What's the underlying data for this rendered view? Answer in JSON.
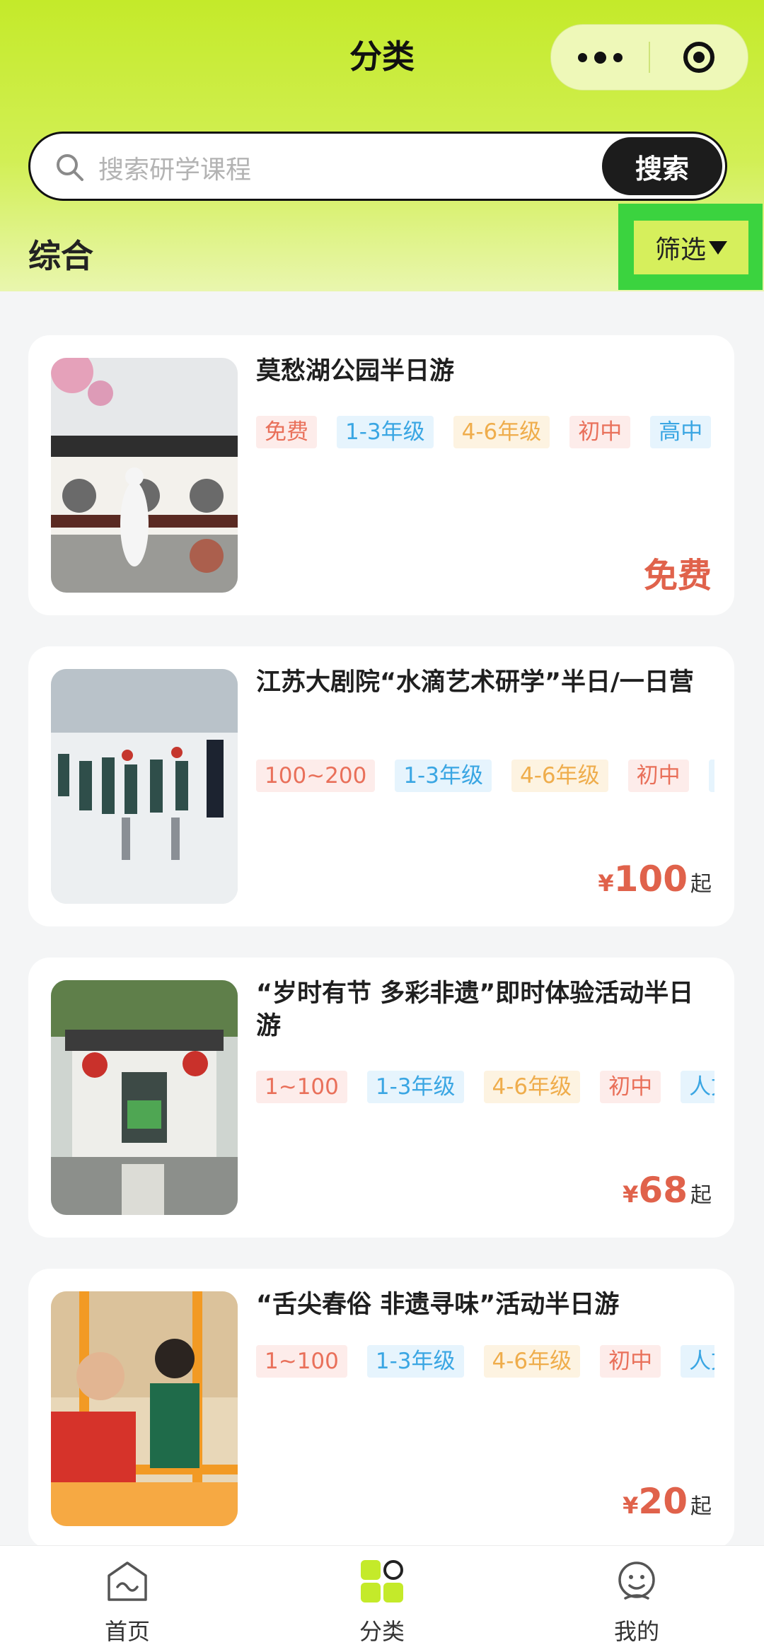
{
  "nav": {
    "title": "分类"
  },
  "search": {
    "placeholder": "搜索研学课程",
    "button": "搜索"
  },
  "sort": {
    "label": "综合"
  },
  "filter": {
    "label": "筛选"
  },
  "courses": [
    {
      "title": "莫愁湖公园半日游",
      "tags": [
        "免费",
        "1-3年级",
        "4-6年级",
        "初中",
        "高中"
      ],
      "price": {
        "text": "免费"
      }
    },
    {
      "title": "江苏大剧院“水滴艺术研学”半日/一日营",
      "tags": [
        "100~200",
        "1-3年级",
        "4-6年级",
        "初中",
        "人"
      ],
      "price": {
        "currency": "¥",
        "value": "100",
        "suffix": "起"
      }
    },
    {
      "title": "“岁时有节 多彩非遗”即时体验活动半日游",
      "tags": [
        "1~100",
        "1-3年级",
        "4-6年级",
        "初中",
        "人文"
      ],
      "price": {
        "currency": "¥",
        "value": "68",
        "suffix": "起"
      }
    },
    {
      "title": "“舌尖春俗 非遗寻味”活动半日游",
      "tags": [
        "1~100",
        "1-3年级",
        "4-6年级",
        "初中",
        "人文"
      ],
      "price": {
        "currency": "¥",
        "value": "20",
        "suffix": "起"
      }
    }
  ],
  "tabbar": {
    "items": [
      {
        "label": "首页",
        "icon": "home-icon"
      },
      {
        "label": "分类",
        "icon": "category-icon",
        "active": true
      },
      {
        "label": "我的",
        "icon": "profile-icon"
      }
    ]
  },
  "colors": {
    "accent": "#c4ea2a",
    "price": "#e0624b",
    "tag_red": "#e9705a",
    "tag_blue": "#3aa6e3",
    "tag_yellow": "#efad4c",
    "highlight": "#3bd33f"
  }
}
